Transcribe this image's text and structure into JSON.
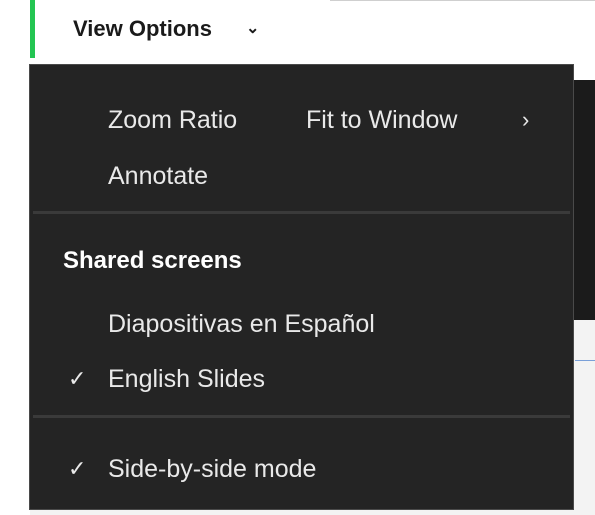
{
  "toolbar": {
    "view_options_label": "View Options",
    "view_options_chevron": "⌄",
    "accent_color": "#23c552"
  },
  "menu": {
    "zoom_label": "Zoom Ratio",
    "zoom_value": "Fit to Window",
    "zoom_chevron": "›",
    "annotate_label": "Annotate",
    "shared_screens_heading": "Shared screens",
    "screens": [
      {
        "label": "Diapositivas en Español",
        "checked": false
      },
      {
        "label": "English Slides",
        "checked": true
      }
    ],
    "side_by_side_label": "Side-by-side mode",
    "side_by_side_checked": true,
    "check_glyph": "✓"
  }
}
